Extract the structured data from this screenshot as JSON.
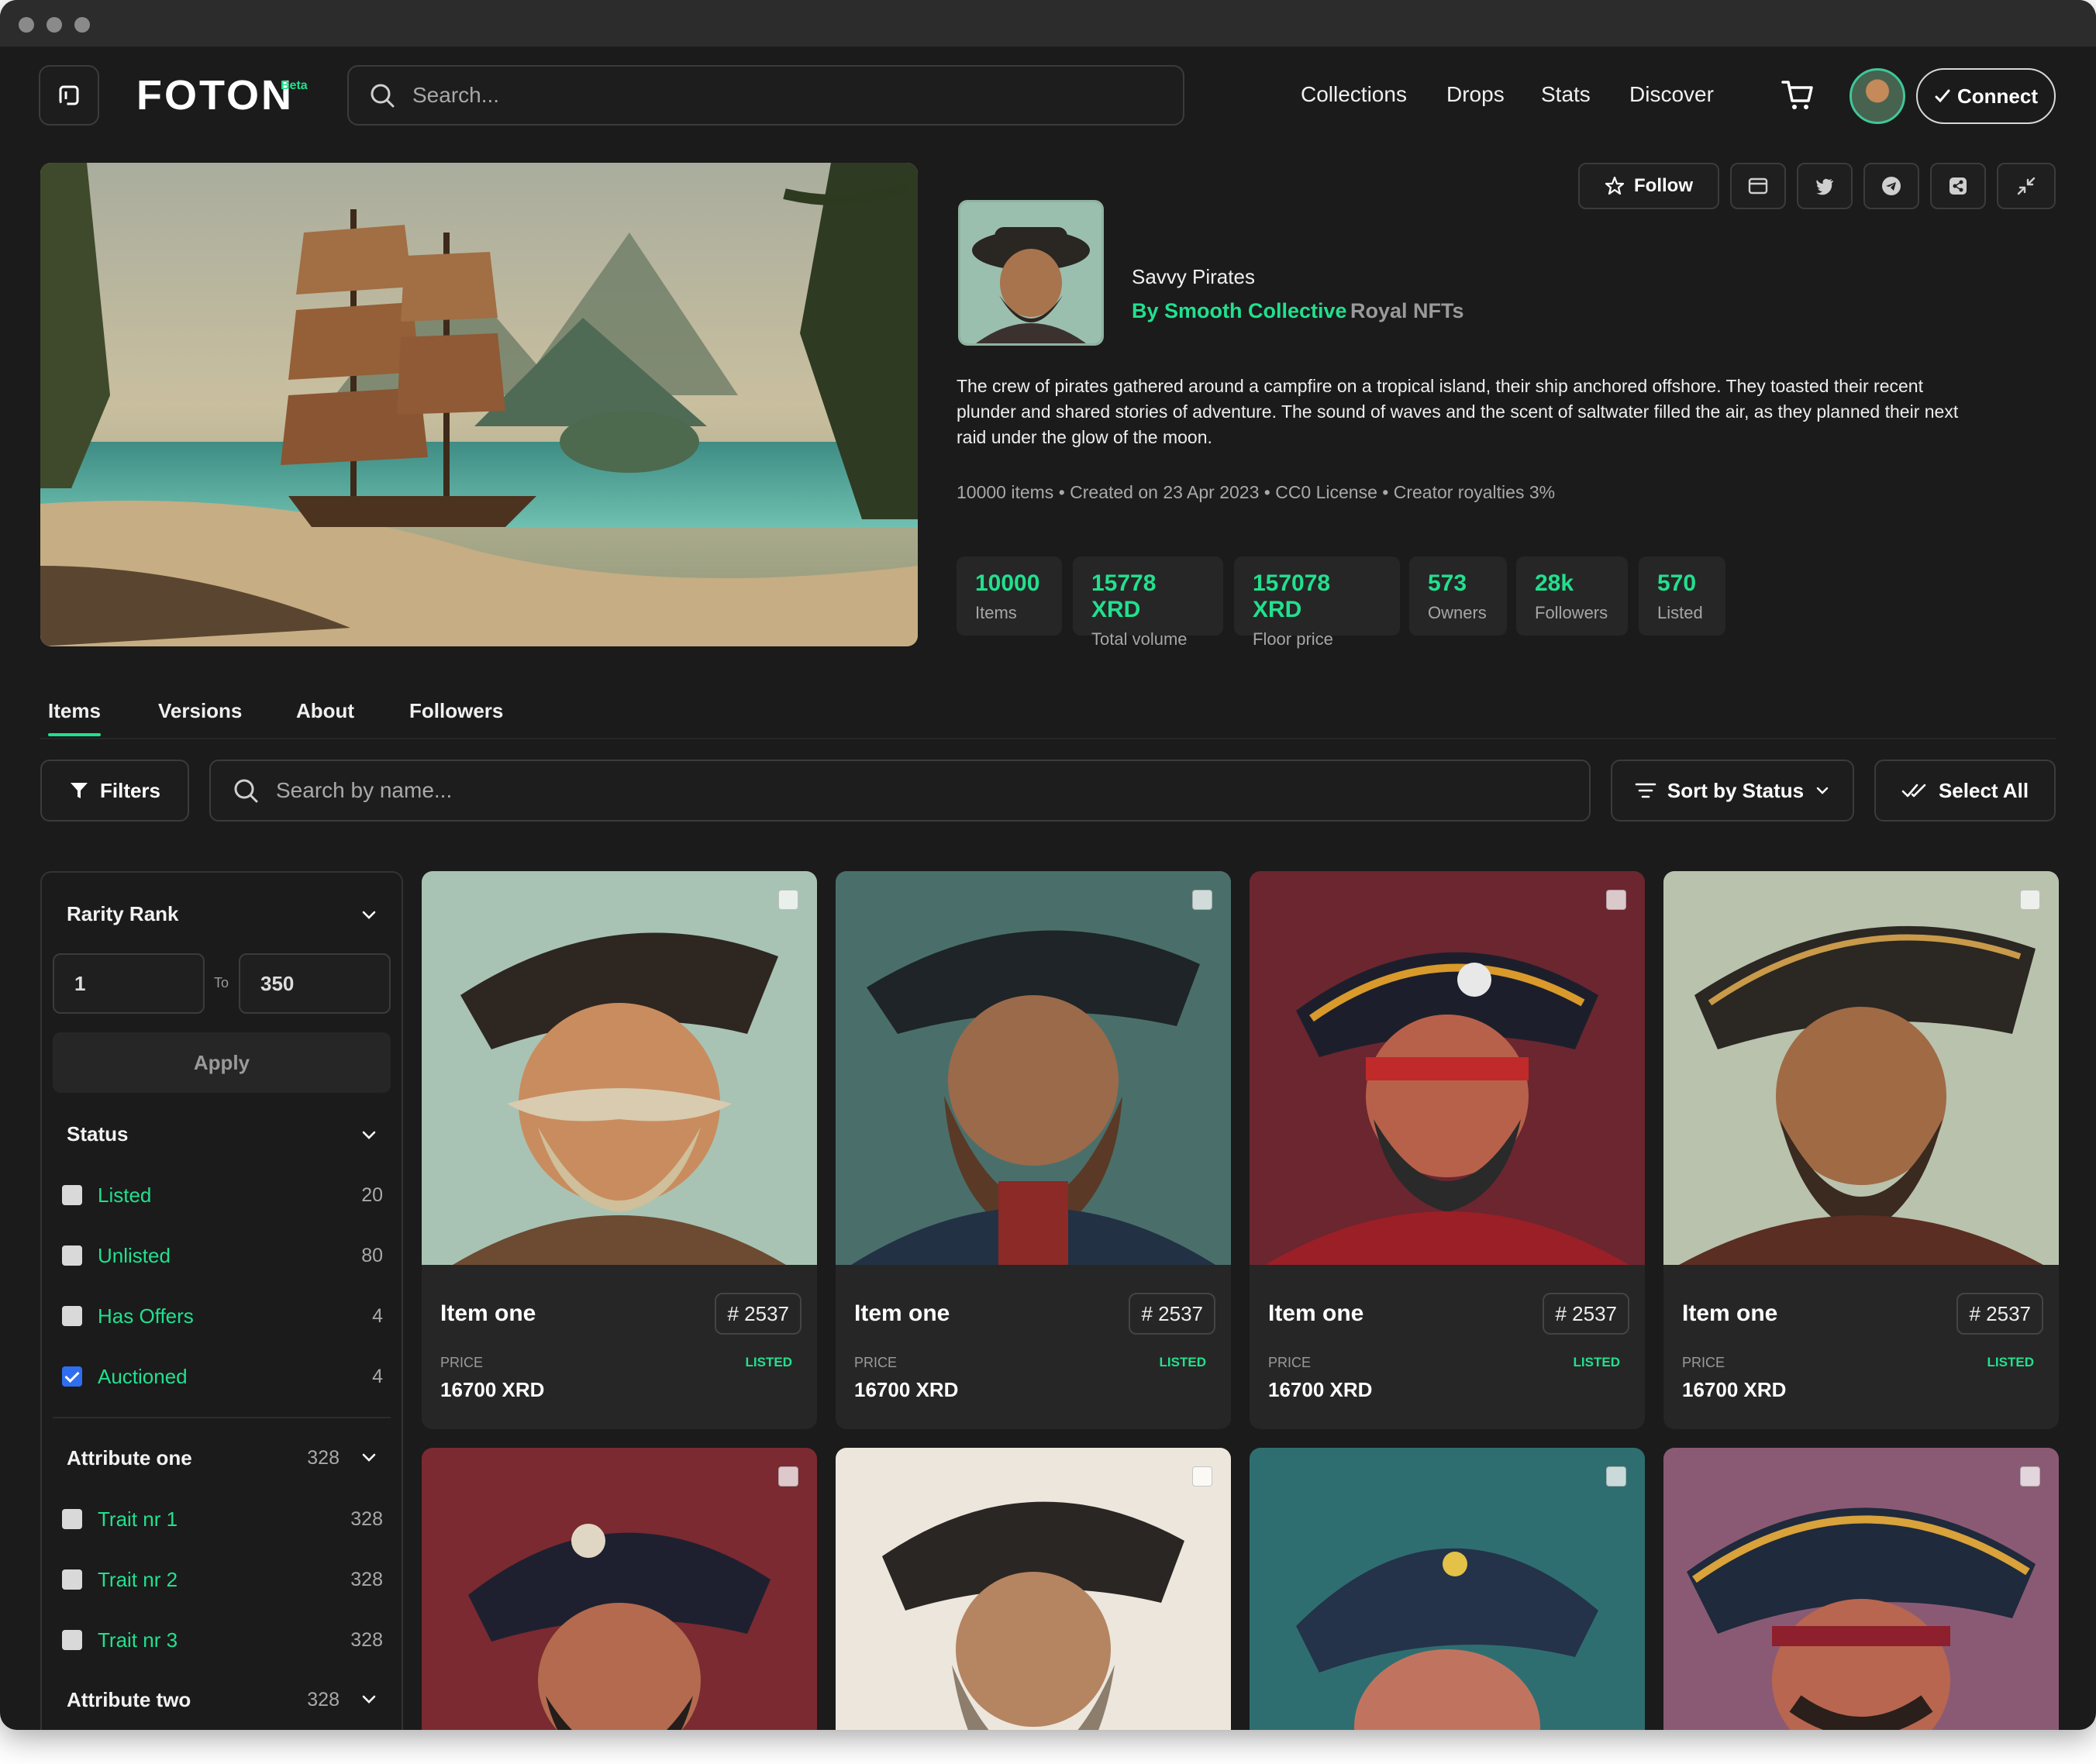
{
  "app": {
    "logo": "FOTON",
    "beta": "Beta",
    "search_placeholder": "Search...",
    "nav": [
      "Collections",
      "Drops",
      "Stats",
      "Discover"
    ],
    "connect_label": "Connect"
  },
  "collection": {
    "name": "Savvy Pirates",
    "by": "By Smooth Collective",
    "publisher": "Royal NFTs",
    "follow_label": "Follow",
    "description": "The crew of pirates gathered around a campfire on a tropical island, their ship anchored offshore. They toasted their recent plunder and shared stories of adventure. The sound of waves and the scent of saltwater filled the air, as they planned their next raid under the glow of the moon.",
    "meta": "10000 items • Created on 23 Apr 2023 • CC0 License • Creator royalties 3%",
    "stats": [
      {
        "value": "10000",
        "label": "Items"
      },
      {
        "value": "15778 XRD",
        "label": "Total volume"
      },
      {
        "value": "157078 XRD",
        "label": "Floor price"
      },
      {
        "value": "573",
        "label": "Owners"
      },
      {
        "value": "28k",
        "label": "Followers"
      },
      {
        "value": "570",
        "label": "Listed"
      }
    ]
  },
  "tabs": [
    "Items",
    "Versions",
    "About",
    "Followers"
  ],
  "toolbar": {
    "filters_label": "Filters",
    "name_search_placeholder": "Search by name...",
    "sort_label": "Sort by Status",
    "select_all_label": "Select All"
  },
  "sidebar": {
    "rarity": {
      "title": "Rarity Rank",
      "from": "1",
      "to_label": "To",
      "to": "350",
      "apply_label": "Apply"
    },
    "status": {
      "title": "Status",
      "options": [
        {
          "label": "Listed",
          "count": "20",
          "checked": false
        },
        {
          "label": "Unlisted",
          "count": "80",
          "checked": false
        },
        {
          "label": "Has Offers",
          "count": "4",
          "checked": false
        },
        {
          "label": "Auctioned",
          "count": "4",
          "checked": true
        }
      ]
    },
    "attribute_one": {
      "title": "Attribute one",
      "count": "328",
      "traits": [
        {
          "label": "Trait nr 1",
          "count": "328"
        },
        {
          "label": "Trait nr 2",
          "count": "328"
        },
        {
          "label": "Trait nr 3",
          "count": "328"
        }
      ]
    },
    "attribute_two": {
      "title": "Attribute two",
      "count": "328"
    }
  },
  "items": [
    {
      "title": "Item one",
      "number": "# 2537",
      "price_label": "PRICE",
      "price": "16700 XRD",
      "status": "LISTED"
    },
    {
      "title": "Item one",
      "number": "# 2537",
      "price_label": "PRICE",
      "price": "16700 XRD",
      "status": "LISTED"
    },
    {
      "title": "Item one",
      "number": "# 2537",
      "price_label": "PRICE",
      "price": "16700 XRD",
      "status": "LISTED"
    },
    {
      "title": "Item one",
      "number": "# 2537",
      "price_label": "PRICE",
      "price": "16700 XRD",
      "status": "LISTED"
    }
  ],
  "colors": {
    "accent": "#22e08e",
    "background": "#1b1b1b",
    "panel": "#262626",
    "border": "#3b3b3b"
  }
}
